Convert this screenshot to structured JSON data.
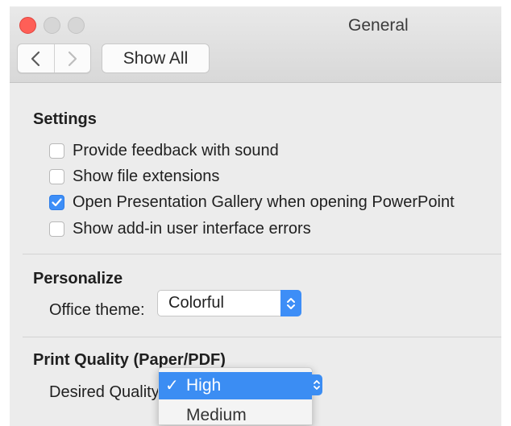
{
  "window": {
    "title": "General"
  },
  "toolbar": {
    "show_all_label": "Show All"
  },
  "sections": {
    "settings": {
      "title": "Settings",
      "options": [
        {
          "label": "Provide feedback with sound",
          "checked": false
        },
        {
          "label": "Show file extensions",
          "checked": false
        },
        {
          "label": "Open Presentation Gallery when opening PowerPoint",
          "checked": true
        },
        {
          "label": "Show add-in user interface errors",
          "checked": false
        }
      ]
    },
    "personalize": {
      "title": "Personalize",
      "theme_label": "Office theme:",
      "theme_value": "Colorful"
    },
    "print_quality": {
      "title": "Print Quality (Paper/PDF)",
      "quality_label": "Desired Quality",
      "menu_options": [
        {
          "label": "High",
          "selected": true
        },
        {
          "label": "Medium",
          "selected": false
        }
      ]
    }
  },
  "colors": {
    "accent": "#3d8ef7",
    "close_button": "#fe5f57",
    "inactive_button": "#d6d6d6"
  },
  "icons": {
    "back": "chevron-left-icon",
    "forward": "chevron-right-icon",
    "check": "checkmark-icon",
    "popup": "up-down-chevron-icon"
  }
}
